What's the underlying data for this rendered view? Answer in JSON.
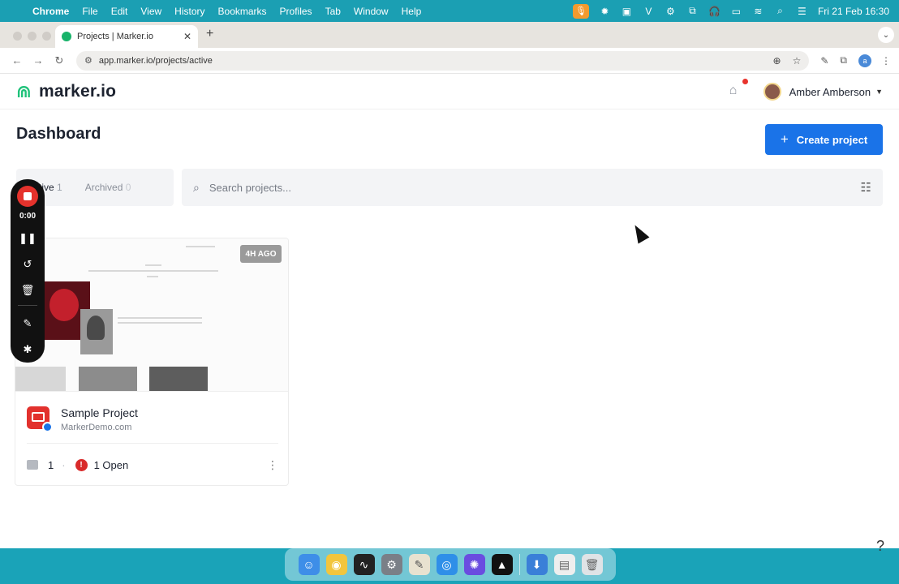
{
  "menubar": {
    "app_name": "Chrome",
    "items": [
      "File",
      "Edit",
      "View",
      "History",
      "Bookmarks",
      "Profiles",
      "Tab",
      "Window",
      "Help"
    ],
    "datetime": "Fri 21 Feb  16:30"
  },
  "browser": {
    "tab_title": "Projects | Marker.io",
    "url": "app.marker.io/projects/active",
    "profile_initial": "a"
  },
  "header": {
    "logo_text": "marker.io",
    "user_name": "Amber Amberson"
  },
  "main": {
    "title": "Dashboard",
    "create_label": "Create project",
    "tabs": [
      {
        "label": "Active",
        "count": "1"
      },
      {
        "label": "Archived",
        "count": "0"
      }
    ],
    "search_placeholder": "Search projects..."
  },
  "project": {
    "time_badge": "4H AGO",
    "name": "Sample Project",
    "domain": "MarkerDemo.com",
    "screenshots": "1",
    "open_label": "1 Open"
  },
  "recorder": {
    "time": "0:00"
  },
  "colors": {
    "accent": "#1a73e8",
    "brand": "#1fc27a",
    "alert": "#d92b2b"
  }
}
